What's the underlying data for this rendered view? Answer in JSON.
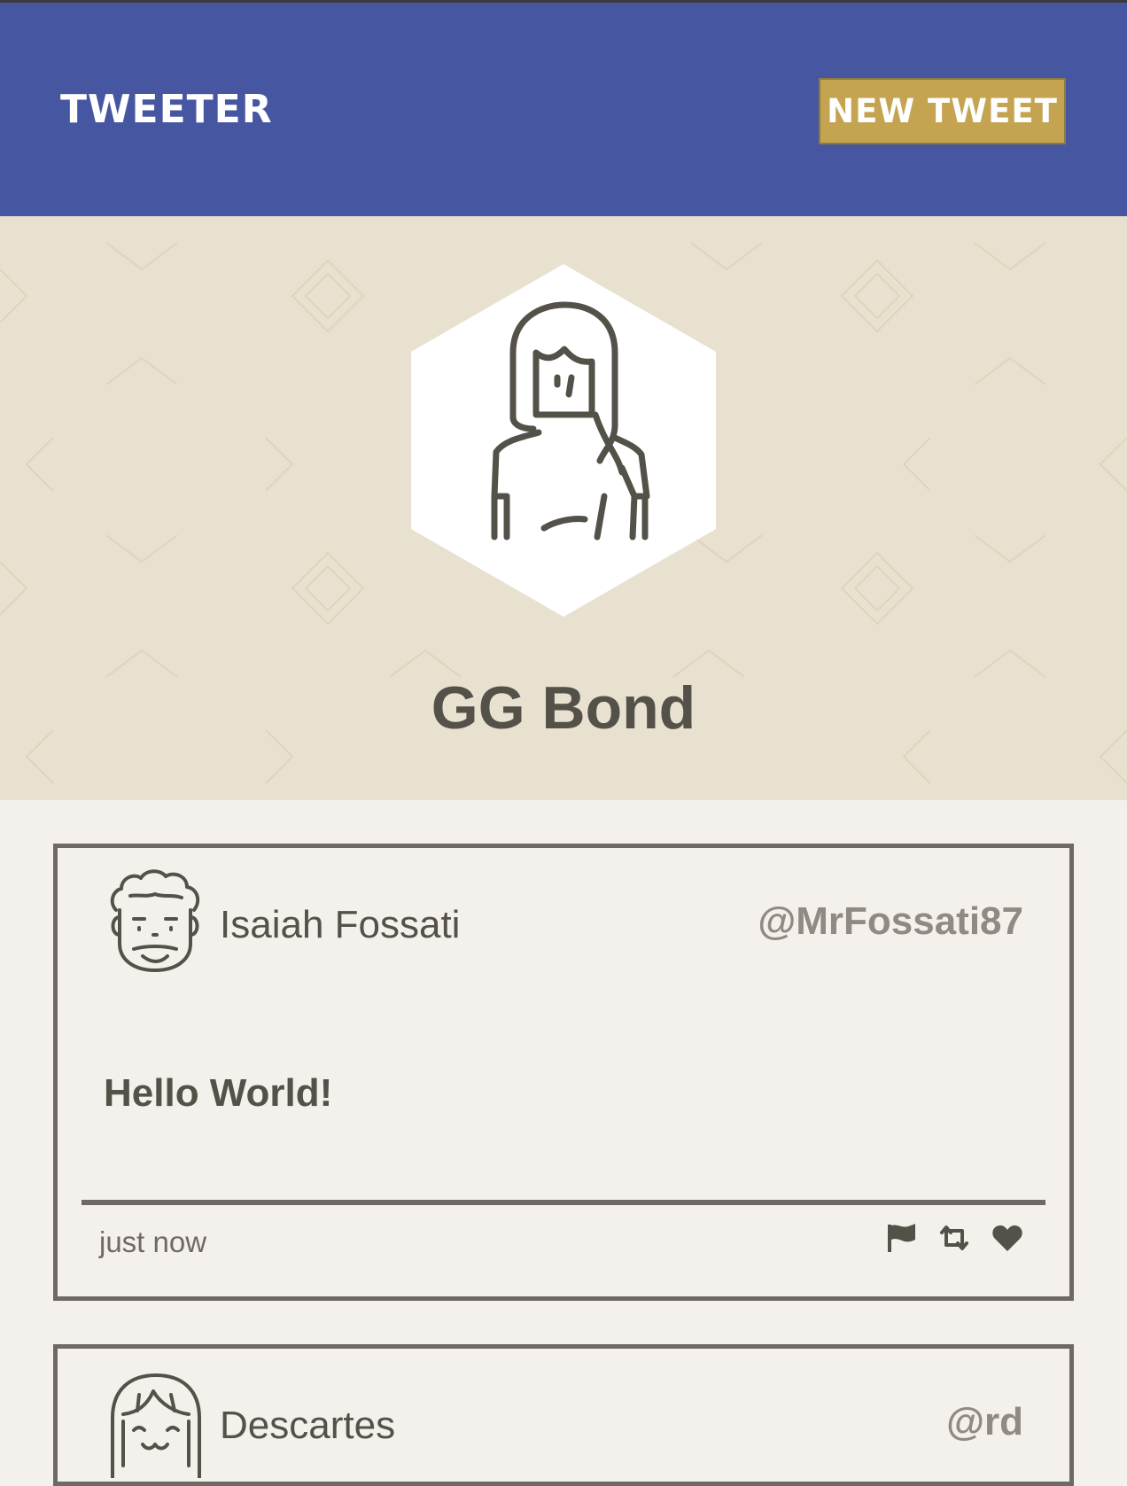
{
  "nav": {
    "brand": "Tweeter",
    "new_tweet_label": "New Tweet"
  },
  "profile": {
    "name": "GG Bond",
    "avatar_icon": "woman-avatar-icon"
  },
  "tweets": [
    {
      "name": "Isaiah Fossati",
      "handle": "@MrFossati87",
      "body": "Hello World!",
      "time": "just now",
      "avatar_icon": "curly-hair-man-avatar-icon",
      "actions": [
        "flag-icon",
        "retweet-icon",
        "heart-icon"
      ]
    },
    {
      "name": "Descartes",
      "handle": "@rd",
      "avatar_icon": "bangs-girl-avatar-icon"
    }
  ],
  "colors": {
    "nav_bg": "#4656a0",
    "button_bg": "#c4a450",
    "profile_bg": "#e8e1d0",
    "page_bg": "#f4f1ec",
    "text": "#545149",
    "border": "#6e6964"
  }
}
